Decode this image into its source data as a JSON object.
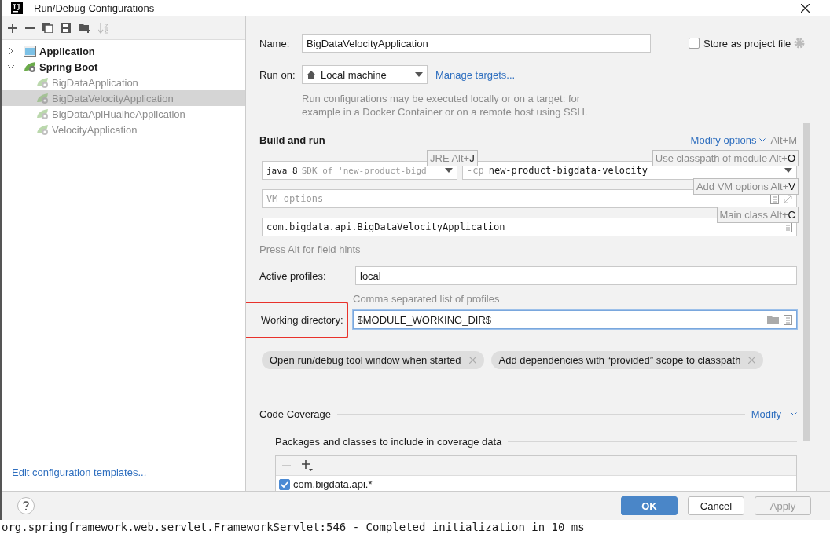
{
  "window": {
    "title": "Run/Debug Configurations"
  },
  "tree": [
    {
      "label": "Application",
      "kind": "application",
      "expanded": false
    },
    {
      "label": "Spring Boot",
      "kind": "spring",
      "expanded": true,
      "children": [
        {
          "label": "BigDataApplication",
          "selected": false
        },
        {
          "label": "BigDataVelocityApplication",
          "selected": true
        },
        {
          "label": "BigDataApiHuaiheApplication",
          "selected": false
        },
        {
          "label": "VelocityApplication",
          "selected": false
        }
      ]
    }
  ],
  "edit_templates_link": "Edit configuration templates...",
  "name": {
    "label": "Name:",
    "value": "BigDataVelocityApplication"
  },
  "store_as_project_file": {
    "label": "Store as project file",
    "checked": false
  },
  "run_on": {
    "label": "Run on:",
    "value": "Local machine",
    "link": "Manage targets...",
    "description": "Run configurations may be executed locally or on a target: for example in a Docker Container or on a remote host using SSH."
  },
  "build_and_run": {
    "title": "Build and run",
    "modify_options": "Modify options",
    "modify_shortcut": "Alt+M",
    "jre": {
      "value": "java 8",
      "hint": "SDK of 'new-product-bigd"
    },
    "classpath": {
      "prefix": "-cp",
      "value": "new-product-bigdata-velocity"
    },
    "vm_options": {
      "placeholder": "VM options"
    },
    "main_class": {
      "value": "com.bigdata.api.BigDataVelocityApplication"
    },
    "field_hint": "Press Alt for field hints",
    "hints": [
      {
        "label": "JRE Alt+",
        "key": "J"
      },
      {
        "label": "Use classpath of module Alt+",
        "key": "O"
      },
      {
        "label": "Add VM options Alt+",
        "key": "V"
      },
      {
        "label": "Main class Alt+",
        "key": "C"
      }
    ]
  },
  "active_profiles": {
    "label": "Active profiles:",
    "value": "local",
    "hint": "Comma separated list of profiles"
  },
  "working_directory": {
    "label": "Working directory:",
    "value": "$MODULE_WORKING_DIR$"
  },
  "options": [
    "Open run/debug tool window when started",
    "Add dependencies with “provided” scope to classpath"
  ],
  "code_coverage": {
    "title": "Code Coverage",
    "modify": "Modify",
    "packages_title": "Packages and classes to include in coverage data",
    "patterns": [
      {
        "label": "com.bigdata.api.*",
        "checked": true
      }
    ]
  },
  "buttons": [
    {
      "label": "OK",
      "kind": "primary"
    },
    {
      "label": "Cancel",
      "kind": "normal"
    },
    {
      "label": "Apply",
      "kind": "disabled"
    }
  ],
  "background_console": "org.springframework.web.servlet.FrameworkServlet:546 - Completed initialization in 10 ms"
}
